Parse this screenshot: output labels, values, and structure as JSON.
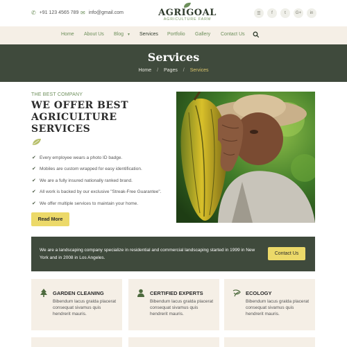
{
  "topbar": {
    "phone": "+91 123 4565 789",
    "email": "info@gmail.com",
    "logo_name": "AGRIGOAL",
    "logo_sub": "AGRICULTURE FARM",
    "socials": [
      {
        "icon": "rss-icon",
        "glyph": "☰"
      },
      {
        "icon": "facebook-icon",
        "glyph": "f"
      },
      {
        "icon": "twitter-icon",
        "glyph": "t"
      },
      {
        "icon": "google-plus-icon",
        "glyph": "G+"
      },
      {
        "icon": "linkedin-icon",
        "glyph": "in"
      }
    ]
  },
  "nav": {
    "items": [
      "Home",
      "About Us",
      "Blog",
      "Services",
      "Portfolio",
      "Gallery",
      "Contact Us"
    ],
    "active": "Services"
  },
  "header": {
    "title": "Services",
    "breadcrumb": [
      "Home",
      "Pages",
      "Services"
    ]
  },
  "about": {
    "eyebrow": "THE BEST COMPANY",
    "headline": "WE OFFER BEST AGRICULTURE SERVICES",
    "checklist": [
      "Every employee wears a photo ID badge.",
      "Mobiles are custom wrapped for easy identification.",
      "We are a fully insured nationally ranked brand.",
      "All work is backed by our exclusive \"Streak-Free Guarantee\".",
      "We offer multiple services to maintain your home."
    ],
    "button": "Read More"
  },
  "cta": {
    "text": "We are a landscaping company specialize in residential and commercial landscaping started in 1999 in New York and in 2008 in Los Angeles.",
    "button": "Contact Us"
  },
  "services": [
    {
      "title": "GARDEN CLEANING",
      "text": "Bibendum lacus gralda placerat consequat sivamus quis hendrerit mauris.",
      "icon": "tree-icon"
    },
    {
      "title": "CERTIFIED EXPERTS",
      "text": "Bibendum lacus gralda placerat consequat sivamus quis hendrerit mauris.",
      "icon": "person-icon"
    },
    {
      "title": "ECOLOGY",
      "text": "Bibendum lacus gralda placerat consequat sivamus quis hendrerit mauris.",
      "icon": "ecology-icon"
    }
  ],
  "colors": {
    "dark_green": "#3f4a3c",
    "accent_green": "#6d8f5b",
    "yellow": "#ecd969",
    "beige": "#f5efe6"
  }
}
